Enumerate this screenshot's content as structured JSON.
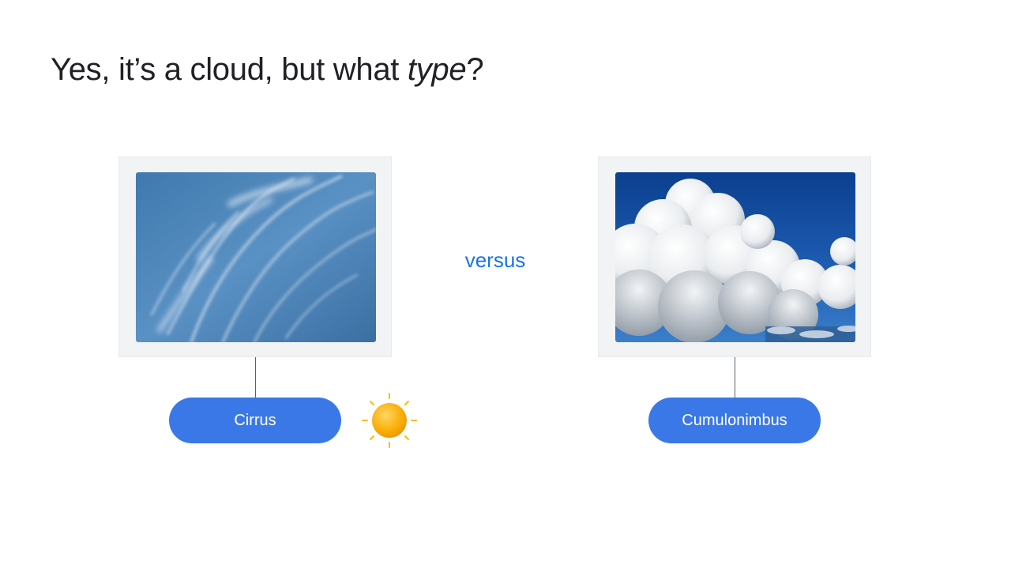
{
  "slide": {
    "title_prefix": "Yes, it’s a cloud, but what ",
    "title_emphasis": "type",
    "title_suffix": "?"
  },
  "comparison": {
    "left": {
      "label": "Cirrus",
      "image": "cirrus-cloud-photo"
    },
    "connector_text": "versus",
    "right": {
      "label": "Cumulonimbus",
      "image": "cumulonimbus-cloud-photo"
    }
  },
  "icons": {
    "sun": "sun-icon"
  },
  "colors": {
    "accent_blue": "#3b78e7",
    "versus_blue": "#1a73e8",
    "sun_yellow": "#f9ab00",
    "title_text": "#202124"
  }
}
